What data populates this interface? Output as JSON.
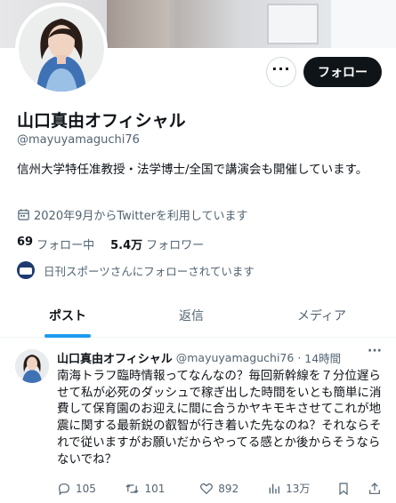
{
  "profile": {
    "name": "山口真由オフィシャル",
    "handle": "@mayuyamaguchi76",
    "bio": "信州大学特任准教授・法学博士/全国で講演会も開催しています。",
    "joined": "2020年9月からTwitterを利用しています",
    "following_count": "69",
    "following_label": "フォロー中",
    "followers_count": "5.4万",
    "followers_label": "フォロワー",
    "followed_by": "日刊スポーツさんにフォローされています"
  },
  "actions": {
    "more_label": "···",
    "follow_label": "フォロー"
  },
  "tabs": [
    {
      "label": "ポスト",
      "active": true
    },
    {
      "label": "返信",
      "active": false
    },
    {
      "label": "メディア",
      "active": false
    }
  ],
  "tweet": {
    "name": "山口真由オフィシャル",
    "handle": "@mayuyamaguchi76",
    "time": "14時間",
    "more": "···",
    "text": "南海トラフ臨時情報ってなんなの？毎回新幹線を７分位遅らせて私が必死のダッシュで稼ぎ出した時間をいとも簡単に消費して保育園のお迎えに間に合うかヤキモキさせてこれが地震に関する最新鋭の叡智が行き着いた先なのね？それならそれで従いますがお願いだからやってる感とか後からそうならないでね？",
    "replies": "105",
    "retweets": "101",
    "likes": "892",
    "views": "13万"
  },
  "colors": {
    "accent": "#1d9bf0",
    "text": "#0f1419",
    "secondary": "#536471",
    "follow_bg": "#0f1419"
  }
}
